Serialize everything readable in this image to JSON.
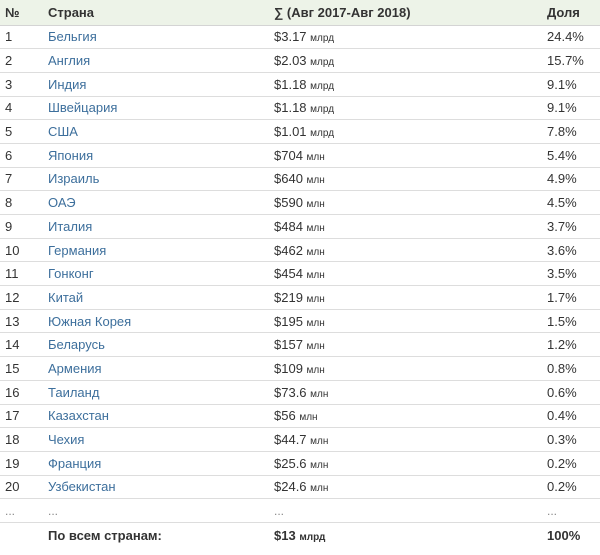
{
  "headers": {
    "num": "№",
    "country": "Страна",
    "sum": "∑ (Авг 2017-Авг 2018)",
    "share": "Доля"
  },
  "rows": [
    {
      "num": "1",
      "country": "Бельгия",
      "amount": "$3.17",
      "unit": "млрд",
      "share": "24.4%"
    },
    {
      "num": "2",
      "country": "Англия",
      "amount": "$2.03",
      "unit": "млрд",
      "share": "15.7%"
    },
    {
      "num": "3",
      "country": "Индия",
      "amount": "$1.18",
      "unit": "млрд",
      "share": "9.1%"
    },
    {
      "num": "4",
      "country": "Швейцария",
      "amount": "$1.18",
      "unit": "млрд",
      "share": "9.1%"
    },
    {
      "num": "5",
      "country": "США",
      "amount": "$1.01",
      "unit": "млрд",
      "share": "7.8%"
    },
    {
      "num": "6",
      "country": "Япония",
      "amount": "$704",
      "unit": "млн",
      "share": "5.4%"
    },
    {
      "num": "7",
      "country": "Израиль",
      "amount": "$640",
      "unit": "млн",
      "share": "4.9%"
    },
    {
      "num": "8",
      "country": "ОАЭ",
      "amount": "$590",
      "unit": "млн",
      "share": "4.5%"
    },
    {
      "num": "9",
      "country": "Италия",
      "amount": "$484",
      "unit": "млн",
      "share": "3.7%"
    },
    {
      "num": "10",
      "country": "Германия",
      "amount": "$462",
      "unit": "млн",
      "share": "3.6%"
    },
    {
      "num": "11",
      "country": "Гонконг",
      "amount": "$454",
      "unit": "млн",
      "share": "3.5%"
    },
    {
      "num": "12",
      "country": "Китай",
      "amount": "$219",
      "unit": "млн",
      "share": "1.7%"
    },
    {
      "num": "13",
      "country": "Южная Корея",
      "amount": "$195",
      "unit": "млн",
      "share": "1.5%"
    },
    {
      "num": "14",
      "country": "Беларусь",
      "amount": "$157",
      "unit": "млн",
      "share": "1.2%"
    },
    {
      "num": "15",
      "country": "Армения",
      "amount": "$109",
      "unit": "млн",
      "share": "0.8%"
    },
    {
      "num": "16",
      "country": "Таиланд",
      "amount": "$73.6",
      "unit": "млн",
      "share": "0.6%"
    },
    {
      "num": "17",
      "country": "Казахстан",
      "amount": "$56",
      "unit": "млн",
      "share": "0.4%"
    },
    {
      "num": "18",
      "country": "Чехия",
      "amount": "$44.7",
      "unit": "млн",
      "share": "0.3%"
    },
    {
      "num": "19",
      "country": "Франция",
      "amount": "$25.6",
      "unit": "млн",
      "share": "0.2%"
    },
    {
      "num": "20",
      "country": "Узбекистан",
      "amount": "$24.6",
      "unit": "млн",
      "share": "0.2%"
    }
  ],
  "ellipsis_row": {
    "num": "...",
    "country": "...",
    "sum": "...",
    "share": "..."
  },
  "total": {
    "label": "По всем странам:",
    "amount": "$13",
    "unit": "млрд",
    "share": "100%"
  }
}
